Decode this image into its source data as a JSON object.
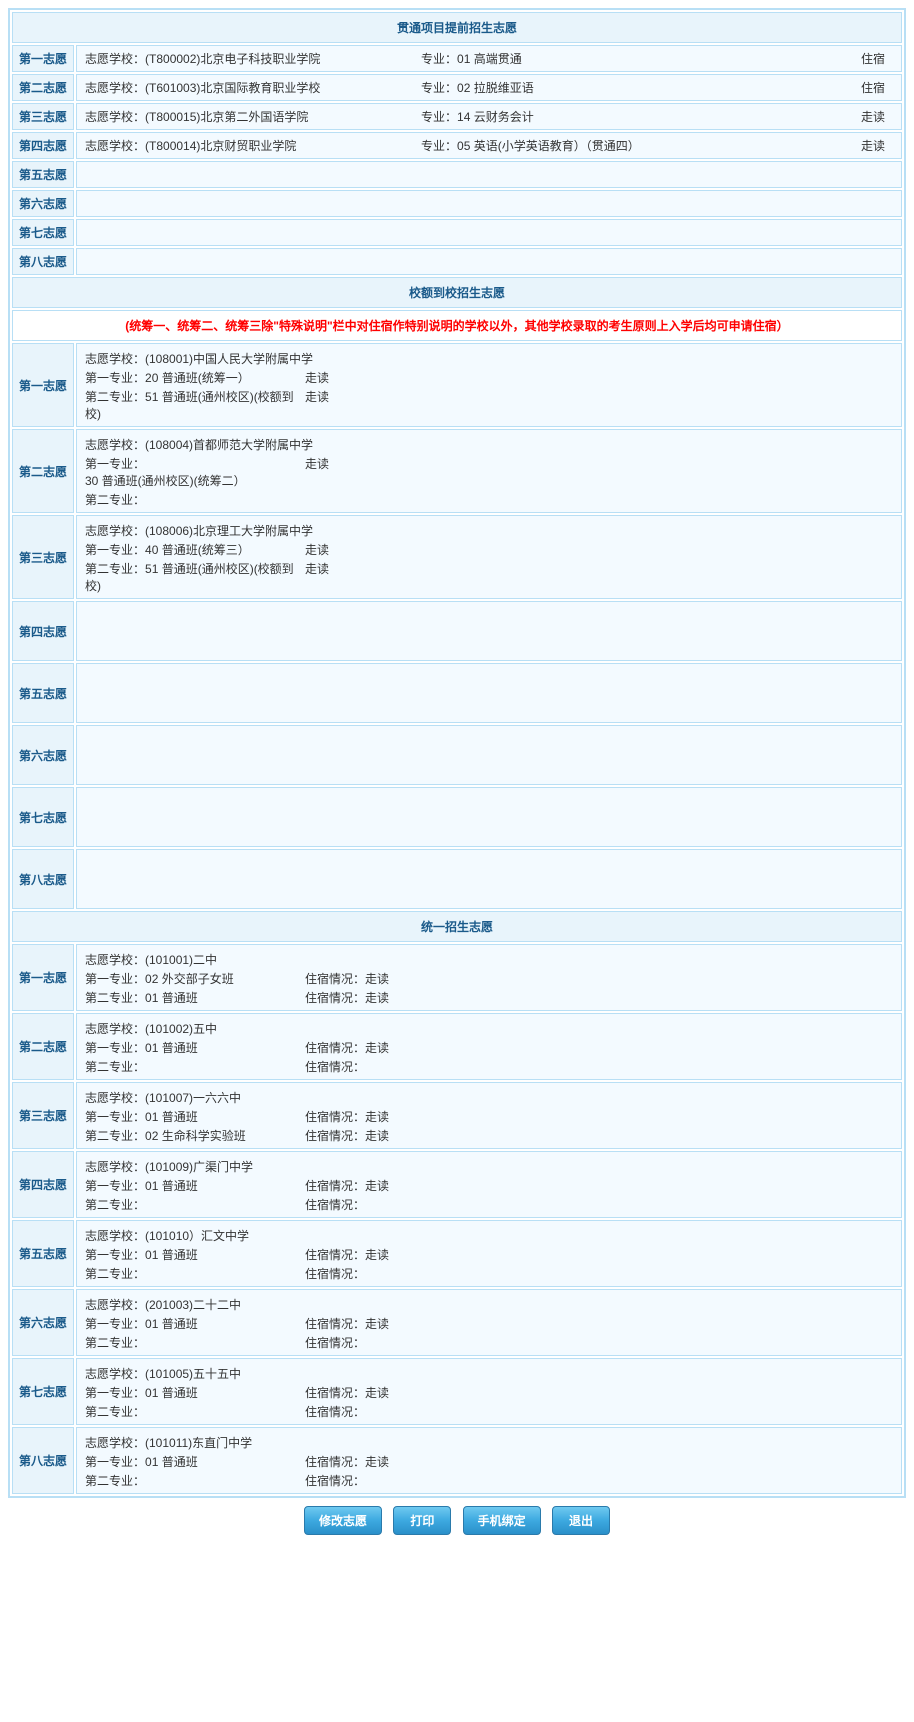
{
  "sections": {
    "s1": {
      "title": "贯通项目提前招生志愿",
      "labels": [
        "第一志愿",
        "第二志愿",
        "第三志愿",
        "第四志愿",
        "第五志愿",
        "第六志愿",
        "第七志愿",
        "第八志愿"
      ],
      "rows": [
        {
          "school_label": "志愿学校：",
          "school": "(T800002)北京电子科技职业学院",
          "major_label": "专业：",
          "major": "01 高端贯通",
          "residence": "住宿"
        },
        {
          "school_label": "志愿学校：",
          "school": "(T601003)北京国际教育职业学校",
          "major_label": "专业：",
          "major": "02 拉脱维亚语",
          "residence": "住宿"
        },
        {
          "school_label": "志愿学校：",
          "school": "(T800015)北京第二外国语学院",
          "major_label": "专业：",
          "major": "14 云财务会计",
          "residence": "走读"
        },
        {
          "school_label": "志愿学校：",
          "school": "(T800014)北京财贸职业学院",
          "major_label": "专业：",
          "major": "05 英语(小学英语教育）（贯通四）",
          "residence": "走读"
        }
      ]
    },
    "s2": {
      "title": "校额到校招生志愿",
      "note": "(统筹一、统筹二、统筹三除\"特殊说明\"栏中对住宿作特别说明的学校以外，其他学校录取的考生原则上入学后均可申请住宿）",
      "labels": [
        "第一志愿",
        "第二志愿",
        "第三志愿",
        "第四志愿",
        "第五志愿",
        "第六志愿",
        "第七志愿",
        "第八志愿"
      ],
      "rows": [
        {
          "school_label": "志愿学校：",
          "school": "(108001)中国人民大学附属中学",
          "m1_label": "第一专业：",
          "m1": "20 普通班(统筹一）",
          "r1": "走读",
          "m2_label": "第二专业：",
          "m2": "51 普通班(通州校区)(校额到校)",
          "r2": "走读"
        },
        {
          "school_label": "志愿学校：",
          "school": "(108004)首都师范大学附属中学",
          "m1_label": "第一专业：",
          "m1": "30 普通班(通州校区)(统筹二）",
          "r1": "走读",
          "m2_label": "第二专业：",
          "m2": "",
          "r2": ""
        },
        {
          "school_label": "志愿学校：",
          "school": "(108006)北京理工大学附属中学",
          "m1_label": "第一专业：",
          "m1": "40 普通班(统筹三）",
          "r1": "走读",
          "m2_label": "第二专业：",
          "m2": "51 普通班(通州校区)(校额到校)",
          "r2": "走读"
        }
      ]
    },
    "s3": {
      "title": "统一招生志愿",
      "labels": [
        "第一志愿",
        "第二志愿",
        "第三志愿",
        "第四志愿",
        "第五志愿",
        "第六志愿",
        "第七志愿",
        "第八志愿"
      ],
      "res_label": "住宿情况：",
      "rows": [
        {
          "school_label": "志愿学校：",
          "school": "(101001)二中",
          "m1_label": "第一专业：",
          "m1": "02 外交部子女班",
          "r1": "走读",
          "m2_label": "第二专业：",
          "m2": "01 普通班",
          "r2": "走读"
        },
        {
          "school_label": "志愿学校：",
          "school": "(101002)五中",
          "m1_label": "第一专业：",
          "m1": "01 普通班",
          "r1": "走读",
          "m2_label": "第二专业：",
          "m2": "",
          "r2": ""
        },
        {
          "school_label": "志愿学校：",
          "school": "(101007)一六六中",
          "m1_label": "第一专业：",
          "m1": "01 普通班",
          "r1": "走读",
          "m2_label": "第二专业：",
          "m2": "02 生命科学实验班",
          "r2": "走读"
        },
        {
          "school_label": "志愿学校：",
          "school": "(101009)广渠门中学",
          "m1_label": "第一专业：",
          "m1": "01 普通班",
          "r1": "走读",
          "m2_label": "第二专业：",
          "m2": "",
          "r2": ""
        },
        {
          "school_label": "志愿学校：",
          "school": "(101010）汇文中学",
          "m1_label": "第一专业：",
          "m1": "01 普通班",
          "r1": "走读",
          "m2_label": "第二专业：",
          "m2": "",
          "r2": ""
        },
        {
          "school_label": "志愿学校：",
          "school": "(201003)二十二中",
          "m1_label": "第一专业：",
          "m1": "01 普通班",
          "r1": "走读",
          "m2_label": "第二专业：",
          "m2": "",
          "r2": ""
        },
        {
          "school_label": "志愿学校：",
          "school": "(101005)五十五中",
          "m1_label": "第一专业：",
          "m1": "01 普通班",
          "r1": "走读",
          "m2_label": "第二专业：",
          "m2": "",
          "r2": ""
        },
        {
          "school_label": "志愿学校：",
          "school": "(101011)东直门中学",
          "m1_label": "第一专业：",
          "m1": "01 普通班",
          "r1": "走读",
          "m2_label": "第二专业：",
          "m2": "",
          "r2": ""
        }
      ]
    }
  },
  "buttons": {
    "edit": "修改志愿",
    "print": "打印",
    "bind": "手机绑定",
    "exit": "退出"
  }
}
